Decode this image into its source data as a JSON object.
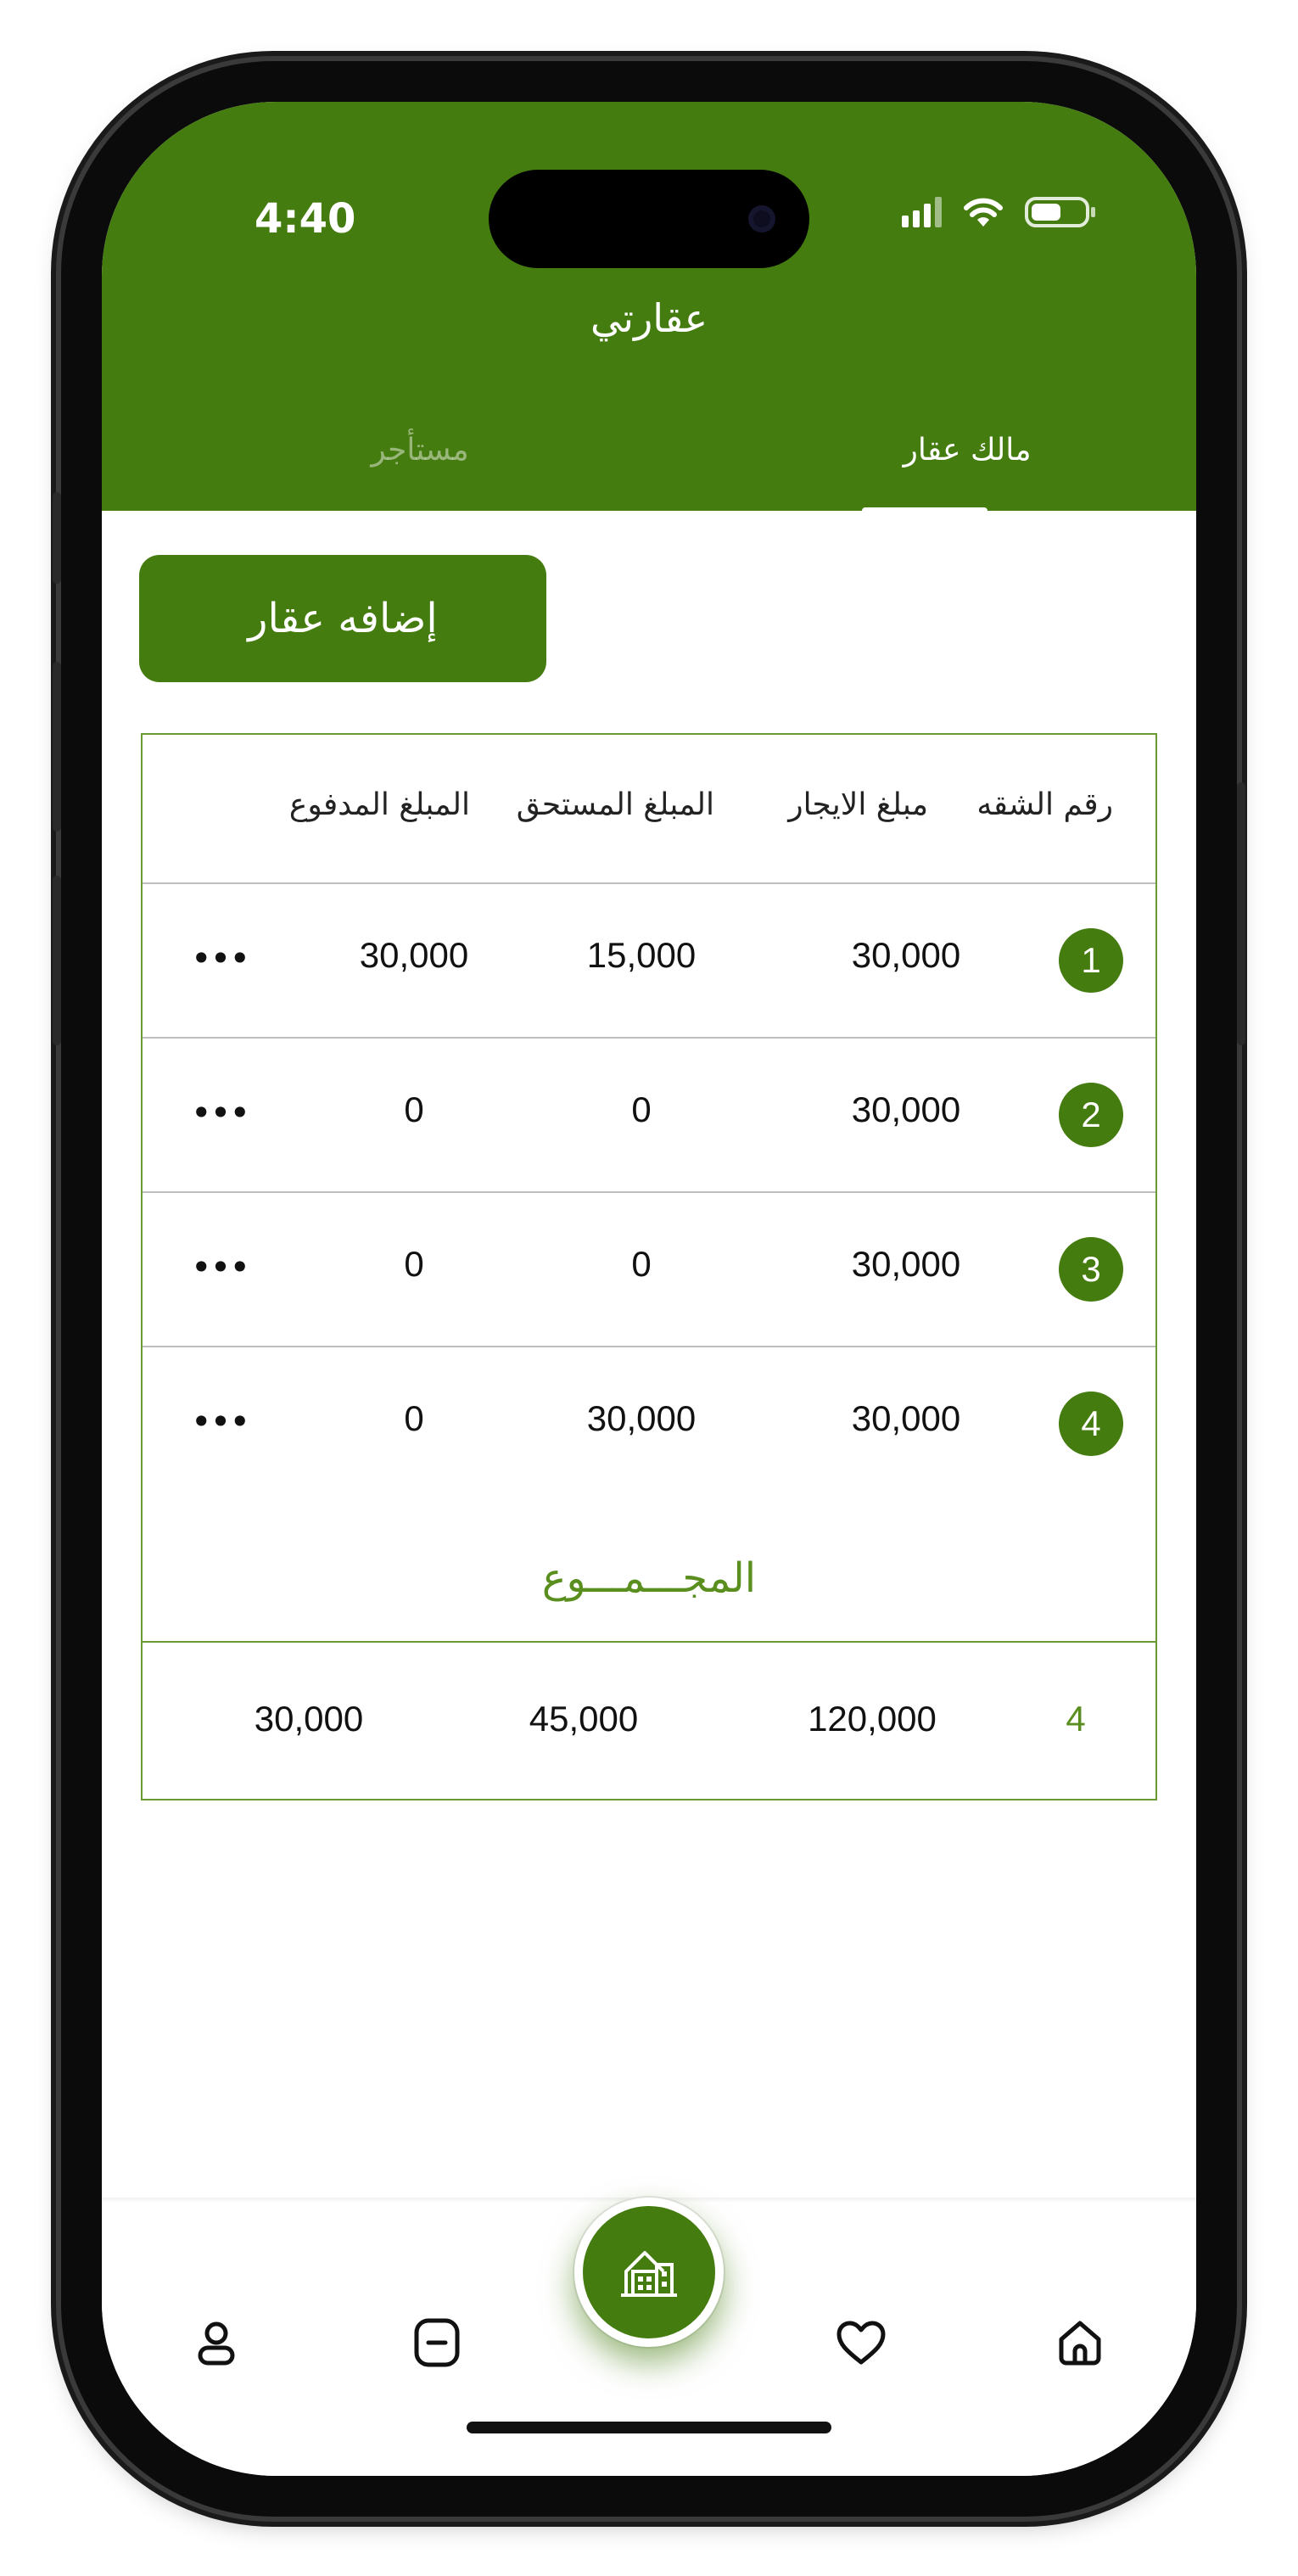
{
  "status_bar": {
    "time": "4:40"
  },
  "header": {
    "title": "عقارتي",
    "tabs": [
      {
        "label": "مالك عقار",
        "active": true
      },
      {
        "label": "مستأجر",
        "active": false
      }
    ]
  },
  "add_button": {
    "label": "إضافه عقار"
  },
  "table": {
    "columns": [
      "رقم الشقه",
      "مبلغ الايجار",
      "المبلغ المستحق",
      "المبلغ المدفوع"
    ],
    "rows": [
      {
        "number": "1",
        "rent": "30,000",
        "due": "15,000",
        "paid": "30,000",
        "more": "•••"
      },
      {
        "number": "2",
        "rent": "30,000",
        "due": "0",
        "paid": "0",
        "more": "•••"
      },
      {
        "number": "3",
        "rent": "30,000",
        "due": "0",
        "paid": "0",
        "more": "•••"
      },
      {
        "number": "4",
        "rent": "30,000",
        "due": "30,000",
        "paid": "0",
        "more": "•••"
      }
    ],
    "total_label": "المجـــمـــوع",
    "totals": {
      "count": "4",
      "rent": "120,000",
      "due": "45,000",
      "paid": "30,000"
    }
  },
  "bottom_nav": {
    "items": [
      "profile-icon",
      "list-icon",
      "building-icon",
      "heart-icon",
      "home-icon"
    ],
    "accent": "#457c10"
  },
  "colors": {
    "primary": "#457c10",
    "border": "#6a9a34",
    "total_text": "#5a8f1f"
  }
}
